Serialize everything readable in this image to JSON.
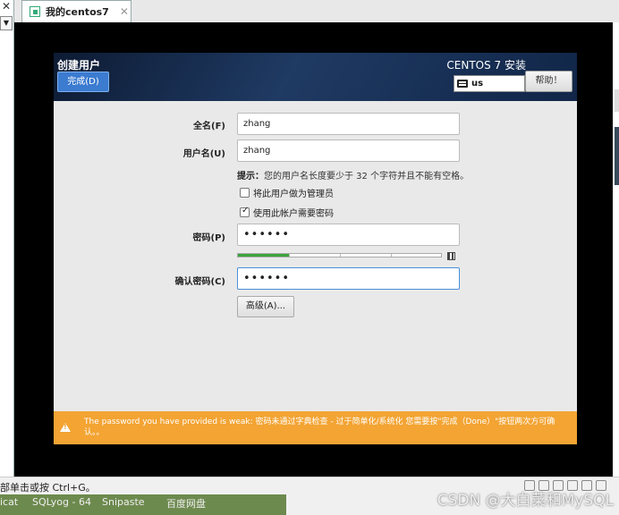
{
  "vm_tab": {
    "title": "我的centos7",
    "close": "✕"
  },
  "left_strip": {
    "close": "✕"
  },
  "installer": {
    "page_title": "创建用户",
    "done_button": "完成(D)",
    "product_title": "CENTOS 7 安装",
    "keyboard_layout": "us",
    "help_button": "帮助！",
    "form": {
      "fullname_label": "全名(F)",
      "fullname_value": "zhang",
      "username_label": "用户名(U)",
      "username_value": "zhang",
      "hint_bold": "提示：",
      "hint_text": "您的用户名长度要少于 32 个字符并且不能有空格。",
      "admin_checkbox_label": "将此用户做为管理员",
      "admin_checked": false,
      "require_password_label": "使用此帐户需要密码",
      "require_password_checked": true,
      "password_label": "密码(P)",
      "password_value": "••••••",
      "password_strength": 0.25,
      "confirm_label": "确认密码(C)",
      "confirm_value": "••••••",
      "advanced_button": "高级(A)..."
    },
    "warning": "The password you have provided is weak: 密码未通过字典检查 - 过于简单化/系统化 您需要按\"完成（Done）\"按钮两次方可确认。。"
  },
  "statusbar": {
    "hint": "部单击或按 Ctrl+G。"
  },
  "taskbar": {
    "items": [
      "icat",
      "SQLyog - 64",
      "Snipaste",
      "百度网盘"
    ]
  },
  "watermark": "CSDN @大白菜和MySQL"
}
